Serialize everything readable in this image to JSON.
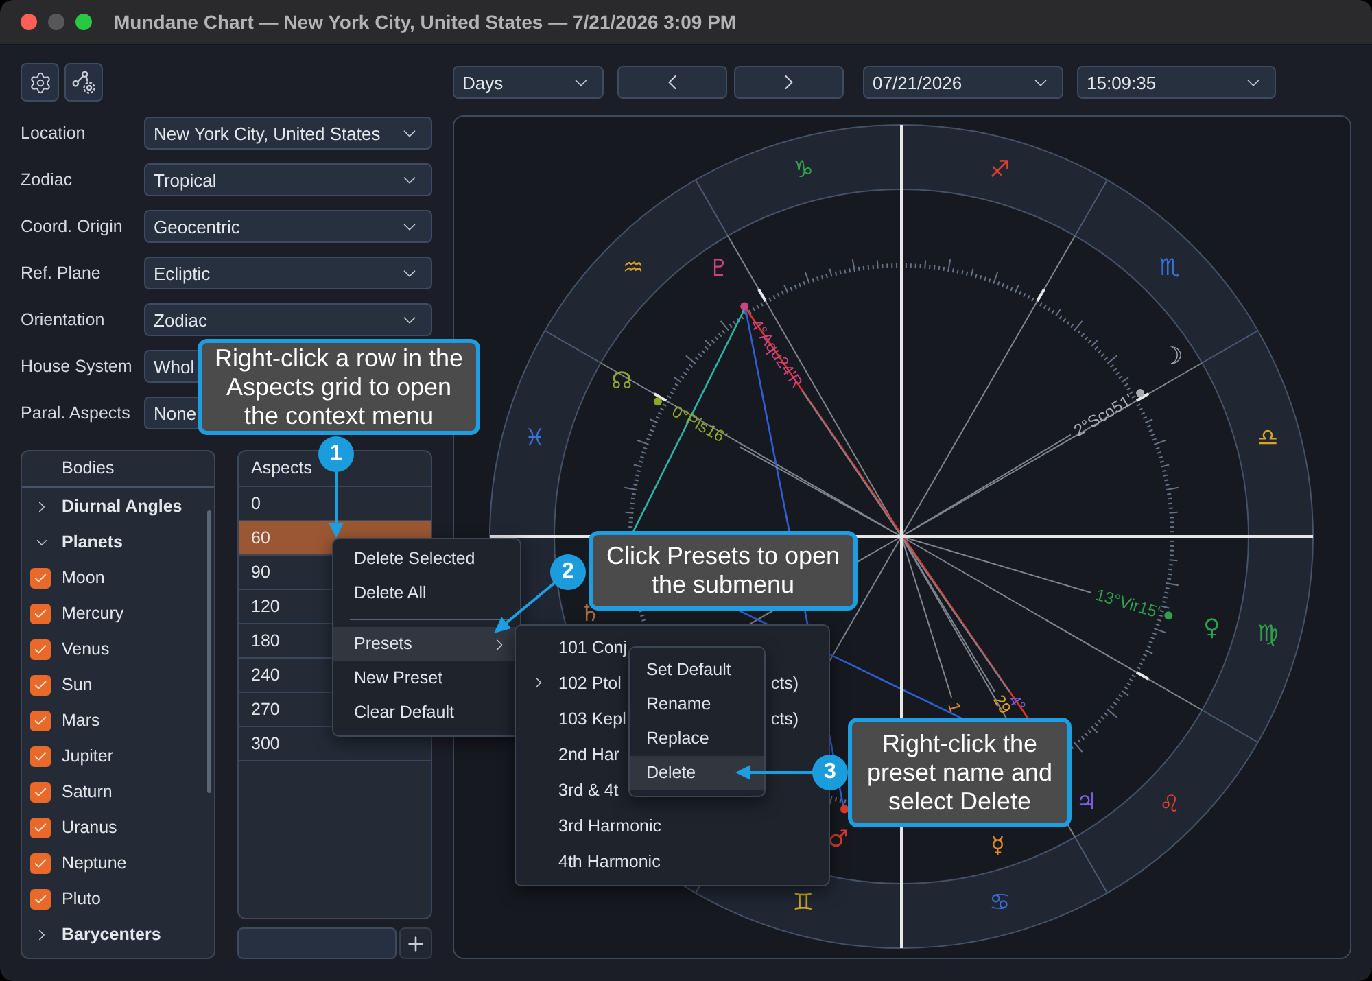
{
  "window": {
    "title": "Mundane Chart — New York City, United States — 7/21/2026 3:09 PM",
    "traffic_lights": [
      {
        "kind": "close",
        "disabled": false
      },
      {
        "kind": "minimize",
        "disabled": true
      },
      {
        "kind": "zoom",
        "disabled": false
      }
    ]
  },
  "settings": [
    {
      "label": "Location",
      "value": "New York City, United States"
    },
    {
      "label": "Zodiac",
      "value": "Tropical"
    },
    {
      "label": "Coord. Origin",
      "value": "Geocentric"
    },
    {
      "label": "Ref. Plane",
      "value": "Ecliptic"
    },
    {
      "label": "Orientation",
      "value": "Zodiac"
    },
    {
      "label": "House System",
      "value": "Whol"
    },
    {
      "label": "Paral. Aspects",
      "value": "None"
    }
  ],
  "bodies": {
    "header": "Bodies",
    "items": [
      {
        "label": "Diurnal Angles",
        "expanded": false
      },
      {
        "label": "Planets",
        "expanded": true,
        "children": [
          {
            "label": "Moon",
            "checked": true
          },
          {
            "label": "Mercury",
            "checked": true
          },
          {
            "label": "Venus",
            "checked": true
          },
          {
            "label": "Sun",
            "checked": true
          },
          {
            "label": "Mars",
            "checked": true
          },
          {
            "label": "Jupiter",
            "checked": true
          },
          {
            "label": "Saturn",
            "checked": true
          },
          {
            "label": "Uranus",
            "checked": true
          },
          {
            "label": "Neptune",
            "checked": true
          },
          {
            "label": "Pluto",
            "checked": true
          }
        ]
      },
      {
        "label": "Barycenters",
        "expanded": false
      }
    ]
  },
  "aspects": {
    "header": "Aspects",
    "rows": [
      {
        "value": "0",
        "selected": false
      },
      {
        "value": "60",
        "selected": true
      },
      {
        "value": "90",
        "selected": false
      },
      {
        "value": "120",
        "selected": false
      },
      {
        "value": "180",
        "selected": false
      },
      {
        "value": "240",
        "selected": false
      },
      {
        "value": "270",
        "selected": false
      },
      {
        "value": "300",
        "selected": false
      }
    ]
  },
  "time_nav": {
    "step": "Days",
    "date": "07/21/2026",
    "time": "15:09:35"
  },
  "chart": {
    "signs": [
      {
        "glyph": "♊",
        "color": "#d8a424"
      },
      {
        "glyph": "♋",
        "color": "#3a6fd8"
      },
      {
        "glyph": "♌",
        "color": "#d9412f"
      },
      {
        "glyph": "♍",
        "color": "#33a048"
      },
      {
        "glyph": "♎",
        "color": "#d8a424"
      },
      {
        "glyph": "♏",
        "color": "#3a6fd8"
      },
      {
        "glyph": "♐",
        "color": "#d9412f"
      },
      {
        "glyph": "♑",
        "color": "#33a048"
      },
      {
        "glyph": "♒",
        "color": "#d8a424"
      },
      {
        "glyph": "♓",
        "color": "#3a6fd8"
      }
    ],
    "planets": [
      {
        "glyph": "♇",
        "label": "4°Aqu24'R",
        "color": "#c8457f"
      },
      {
        "glyph": "☊",
        "label": "0°Pis16'",
        "color": "#8ea62a"
      },
      {
        "glyph": "☽",
        "label": "2°Sco51'",
        "color": "#a8acb3"
      },
      {
        "glyph": "♀",
        "label": "13°Vir15'",
        "color": "#2f9f4e"
      },
      {
        "glyph": "♃",
        "label": "4°",
        "color": "#7b5ce0"
      },
      {
        "label": "29",
        "color": "#d9a521"
      },
      {
        "glyph": "☿",
        "label": "1",
        "color": "#df8c2a"
      },
      {
        "glyph": "♄",
        "color": "#a8713f"
      },
      {
        "glyph": "♂",
        "color": "#d83a2e"
      }
    ]
  },
  "context_menu": {
    "items": [
      {
        "kind": "item",
        "label": "Delete Selected",
        "selected": false
      },
      {
        "kind": "item",
        "label": "Delete All",
        "selected": false
      },
      {
        "kind": "separator"
      },
      {
        "kind": "submenu",
        "label": "Presets",
        "selected": true
      },
      {
        "kind": "item",
        "label": "New Preset",
        "selected": false
      },
      {
        "kind": "item",
        "label": "Clear Default",
        "selected": false
      }
    ]
  },
  "presets_menu": {
    "items": [
      {
        "label": "101 Conj",
        "current": false
      },
      {
        "label": "102 Ptol",
        "tail": "cts)",
        "current": true
      },
      {
        "label": "103 Kepl",
        "tail": "cts)",
        "current": false
      },
      {
        "label": "2nd Har",
        "current": false
      },
      {
        "label": "3rd & 4t",
        "current": false
      },
      {
        "label": "3rd Harmonic",
        "current": false
      },
      {
        "label": "4th Harmonic",
        "current": false
      }
    ]
  },
  "preset_actions_menu": {
    "items": [
      {
        "label": "Set Default",
        "selected": false
      },
      {
        "label": "Rename",
        "selected": false
      },
      {
        "label": "Replace",
        "selected": false
      },
      {
        "label": "Delete",
        "selected": true
      }
    ]
  },
  "callouts": [
    {
      "number": "1",
      "text": "Right-click a row in the\nAspects grid to open\nthe context menu"
    },
    {
      "number": "2",
      "text": "Click Presets to open\nthe submenu"
    },
    {
      "number": "3",
      "text": "Right-click the\npreset name and\nselect Delete"
    }
  ]
}
